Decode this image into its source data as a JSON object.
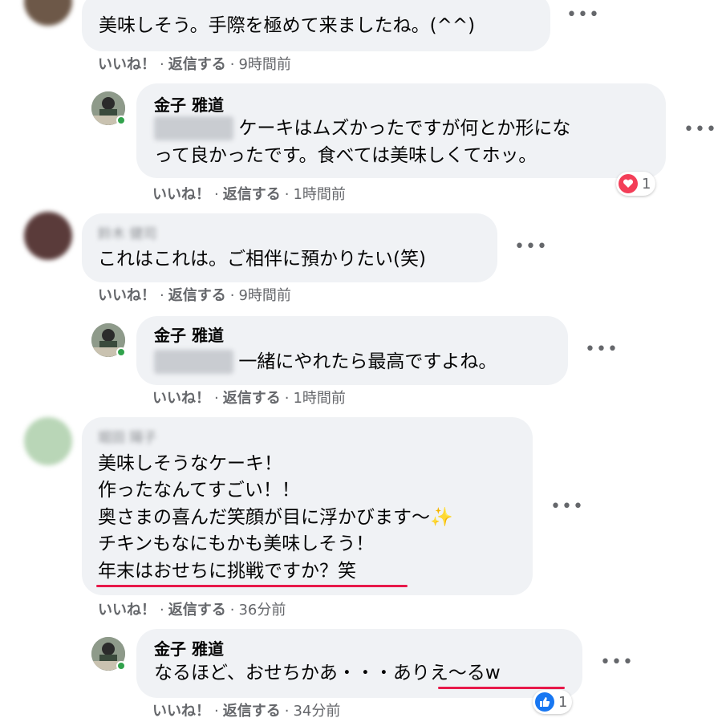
{
  "comments": [
    {
      "author": "",
      "lines": [
        "美味しそう。手際を極めて来ましたね。(^^)"
      ],
      "like_label": "いいね！",
      "reply_label": "返信する",
      "time": "9時間前"
    },
    {
      "author": "金子 雅道",
      "mention": "",
      "lines": [
        "ケーキはムズかったですが何とか形にな",
        "って良かったです。食べては美味しくてホッ。"
      ],
      "like_label": "いいね！",
      "reply_label": "返信する",
      "time": "1時間前",
      "reaction": {
        "type": "love",
        "count": "1"
      }
    },
    {
      "author": "",
      "lines": [
        "これはこれは。ご相伴に預かりたい(笑)"
      ],
      "like_label": "いいね！",
      "reply_label": "返信する",
      "time": "9時間前"
    },
    {
      "author": "金子 雅道",
      "mention": "",
      "lines": [
        "一緒にやれたら最高ですよね。"
      ],
      "like_label": "いいね！",
      "reply_label": "返信する",
      "time": "1時間前"
    },
    {
      "author": "",
      "lines": [
        "美味しそうなケーキ！",
        "作ったなんてすごい！！",
        "奥さまの喜んだ笑顔が目に浮かびます～",
        "チキンもなにもかも美味しそう！",
        "年末はおせちに挑戦ですか？笑"
      ],
      "sparkle": "✨",
      "like_label": "いいね！",
      "reply_label": "返信する",
      "time": "36分前"
    },
    {
      "author": "金子 雅道",
      "lines": [
        "なるほど、おせちかあ・・・ありえ～るw"
      ],
      "like_label": "いいね！",
      "reply_label": "返信する",
      "time": "34分前",
      "reaction": {
        "type": "like",
        "count": "1"
      }
    }
  ],
  "separator_dot": "·",
  "more_icon": "•••",
  "colors": {
    "underline": "#e8194a",
    "online": "#31a24c",
    "love": "#f33e58",
    "like": "#1877f2",
    "bubble": "#f0f2f5"
  }
}
